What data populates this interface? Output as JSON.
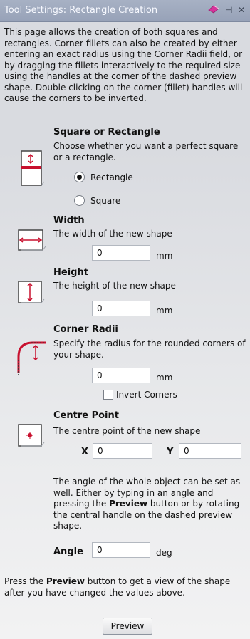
{
  "panel": {
    "title": "Tool Settings: Rectangle Creation",
    "pin_icon_glyph": "⊣",
    "close_icon_glyph": "✕",
    "intro": "This page allows the creation of both squares and rectangles. Corner fillets can also be created by either entering an exact radius using the Corner Radii field, or by dragging the fillets interactively to the required size using the handles at the corner of the dashed preview shape. Double clicking on the corner (fillet) handles will cause the corners to be inverted."
  },
  "shape": {
    "title": "Square or Rectangle",
    "desc": "Choose whether you want a perfect square or a rectangle.",
    "options": [
      "Rectangle",
      "Square"
    ],
    "selected": "Rectangle",
    "icon": "square-or-rectangle-icon"
  },
  "width": {
    "title": "Width",
    "desc": "The width of the new shape",
    "value": "0",
    "unit": "mm",
    "icon": "width-icon"
  },
  "height": {
    "title": "Height",
    "desc": "The height of the new shape",
    "value": "0",
    "unit": "mm",
    "icon": "height-icon"
  },
  "corner": {
    "title": "Corner Radii",
    "desc": "Specify the radius for the rounded corners of your shape.",
    "value": "0",
    "unit": "mm",
    "invert_label": "Invert Corners",
    "invert_checked": false,
    "icon": "corner-radii-icon"
  },
  "centre": {
    "title": "Centre Point",
    "desc": "The centre point of the new shape",
    "x_label": "X",
    "x_value": "0",
    "y_label": "Y",
    "y_value": "0",
    "icon": "centre-point-icon"
  },
  "angle": {
    "desc_before": "The angle of the whole object can be set as well. Either by typing in an angle and pressing the ",
    "desc_bold": "Preview",
    "desc_after": " button or by rotating the central handle on the dashed preview shape.",
    "label": "Angle",
    "value": "0",
    "unit": "deg"
  },
  "footer": {
    "note_before": "Press the ",
    "note_bold": "Preview",
    "note_after": " button to get a view of the shape after you have changed the values above.",
    "preview_label": "Preview"
  },
  "colors": {
    "accent_red": "#c8102e",
    "tab_icon_pink": "#d6339b"
  }
}
